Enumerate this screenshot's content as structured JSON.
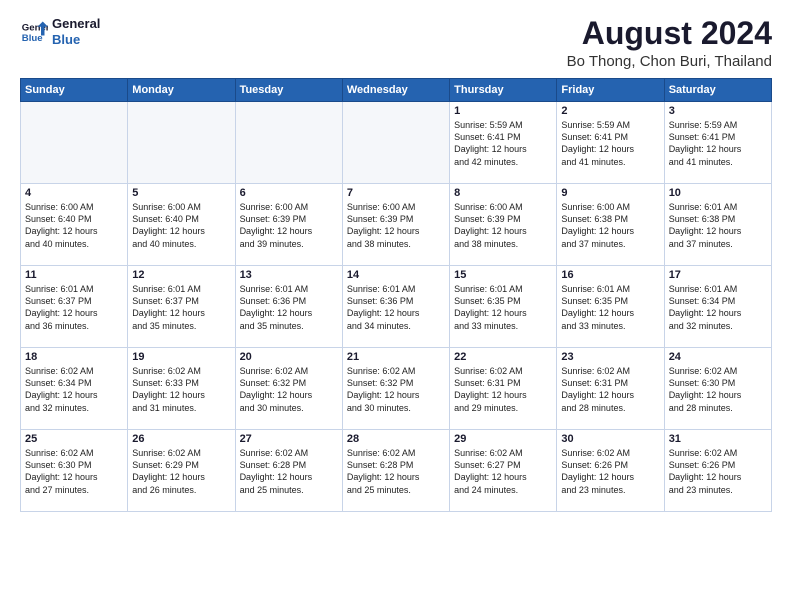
{
  "header": {
    "logo_line1": "General",
    "logo_line2": "Blue",
    "main_title": "August 2024",
    "sub_title": "Bo Thong, Chon Buri, Thailand"
  },
  "weekdays": [
    "Sunday",
    "Monday",
    "Tuesday",
    "Wednesday",
    "Thursday",
    "Friday",
    "Saturday"
  ],
  "rows": [
    [
      {
        "day": "",
        "content": ""
      },
      {
        "day": "",
        "content": ""
      },
      {
        "day": "",
        "content": ""
      },
      {
        "day": "",
        "content": ""
      },
      {
        "day": "1",
        "content": "Sunrise: 5:59 AM\nSunset: 6:41 PM\nDaylight: 12 hours\nand 42 minutes."
      },
      {
        "day": "2",
        "content": "Sunrise: 5:59 AM\nSunset: 6:41 PM\nDaylight: 12 hours\nand 41 minutes."
      },
      {
        "day": "3",
        "content": "Sunrise: 5:59 AM\nSunset: 6:41 PM\nDaylight: 12 hours\nand 41 minutes."
      }
    ],
    [
      {
        "day": "4",
        "content": "Sunrise: 6:00 AM\nSunset: 6:40 PM\nDaylight: 12 hours\nand 40 minutes."
      },
      {
        "day": "5",
        "content": "Sunrise: 6:00 AM\nSunset: 6:40 PM\nDaylight: 12 hours\nand 40 minutes."
      },
      {
        "day": "6",
        "content": "Sunrise: 6:00 AM\nSunset: 6:39 PM\nDaylight: 12 hours\nand 39 minutes."
      },
      {
        "day": "7",
        "content": "Sunrise: 6:00 AM\nSunset: 6:39 PM\nDaylight: 12 hours\nand 38 minutes."
      },
      {
        "day": "8",
        "content": "Sunrise: 6:00 AM\nSunset: 6:39 PM\nDaylight: 12 hours\nand 38 minutes."
      },
      {
        "day": "9",
        "content": "Sunrise: 6:00 AM\nSunset: 6:38 PM\nDaylight: 12 hours\nand 37 minutes."
      },
      {
        "day": "10",
        "content": "Sunrise: 6:01 AM\nSunset: 6:38 PM\nDaylight: 12 hours\nand 37 minutes."
      }
    ],
    [
      {
        "day": "11",
        "content": "Sunrise: 6:01 AM\nSunset: 6:37 PM\nDaylight: 12 hours\nand 36 minutes."
      },
      {
        "day": "12",
        "content": "Sunrise: 6:01 AM\nSunset: 6:37 PM\nDaylight: 12 hours\nand 35 minutes."
      },
      {
        "day": "13",
        "content": "Sunrise: 6:01 AM\nSunset: 6:36 PM\nDaylight: 12 hours\nand 35 minutes."
      },
      {
        "day": "14",
        "content": "Sunrise: 6:01 AM\nSunset: 6:36 PM\nDaylight: 12 hours\nand 34 minutes."
      },
      {
        "day": "15",
        "content": "Sunrise: 6:01 AM\nSunset: 6:35 PM\nDaylight: 12 hours\nand 33 minutes."
      },
      {
        "day": "16",
        "content": "Sunrise: 6:01 AM\nSunset: 6:35 PM\nDaylight: 12 hours\nand 33 minutes."
      },
      {
        "day": "17",
        "content": "Sunrise: 6:01 AM\nSunset: 6:34 PM\nDaylight: 12 hours\nand 32 minutes."
      }
    ],
    [
      {
        "day": "18",
        "content": "Sunrise: 6:02 AM\nSunset: 6:34 PM\nDaylight: 12 hours\nand 32 minutes."
      },
      {
        "day": "19",
        "content": "Sunrise: 6:02 AM\nSunset: 6:33 PM\nDaylight: 12 hours\nand 31 minutes."
      },
      {
        "day": "20",
        "content": "Sunrise: 6:02 AM\nSunset: 6:32 PM\nDaylight: 12 hours\nand 30 minutes."
      },
      {
        "day": "21",
        "content": "Sunrise: 6:02 AM\nSunset: 6:32 PM\nDaylight: 12 hours\nand 30 minutes."
      },
      {
        "day": "22",
        "content": "Sunrise: 6:02 AM\nSunset: 6:31 PM\nDaylight: 12 hours\nand 29 minutes."
      },
      {
        "day": "23",
        "content": "Sunrise: 6:02 AM\nSunset: 6:31 PM\nDaylight: 12 hours\nand 28 minutes."
      },
      {
        "day": "24",
        "content": "Sunrise: 6:02 AM\nSunset: 6:30 PM\nDaylight: 12 hours\nand 28 minutes."
      }
    ],
    [
      {
        "day": "25",
        "content": "Sunrise: 6:02 AM\nSunset: 6:30 PM\nDaylight: 12 hours\nand 27 minutes."
      },
      {
        "day": "26",
        "content": "Sunrise: 6:02 AM\nSunset: 6:29 PM\nDaylight: 12 hours\nand 26 minutes."
      },
      {
        "day": "27",
        "content": "Sunrise: 6:02 AM\nSunset: 6:28 PM\nDaylight: 12 hours\nand 25 minutes."
      },
      {
        "day": "28",
        "content": "Sunrise: 6:02 AM\nSunset: 6:28 PM\nDaylight: 12 hours\nand 25 minutes."
      },
      {
        "day": "29",
        "content": "Sunrise: 6:02 AM\nSunset: 6:27 PM\nDaylight: 12 hours\nand 24 minutes."
      },
      {
        "day": "30",
        "content": "Sunrise: 6:02 AM\nSunset: 6:26 PM\nDaylight: 12 hours\nand 23 minutes."
      },
      {
        "day": "31",
        "content": "Sunrise: 6:02 AM\nSunset: 6:26 PM\nDaylight: 12 hours\nand 23 minutes."
      }
    ]
  ]
}
